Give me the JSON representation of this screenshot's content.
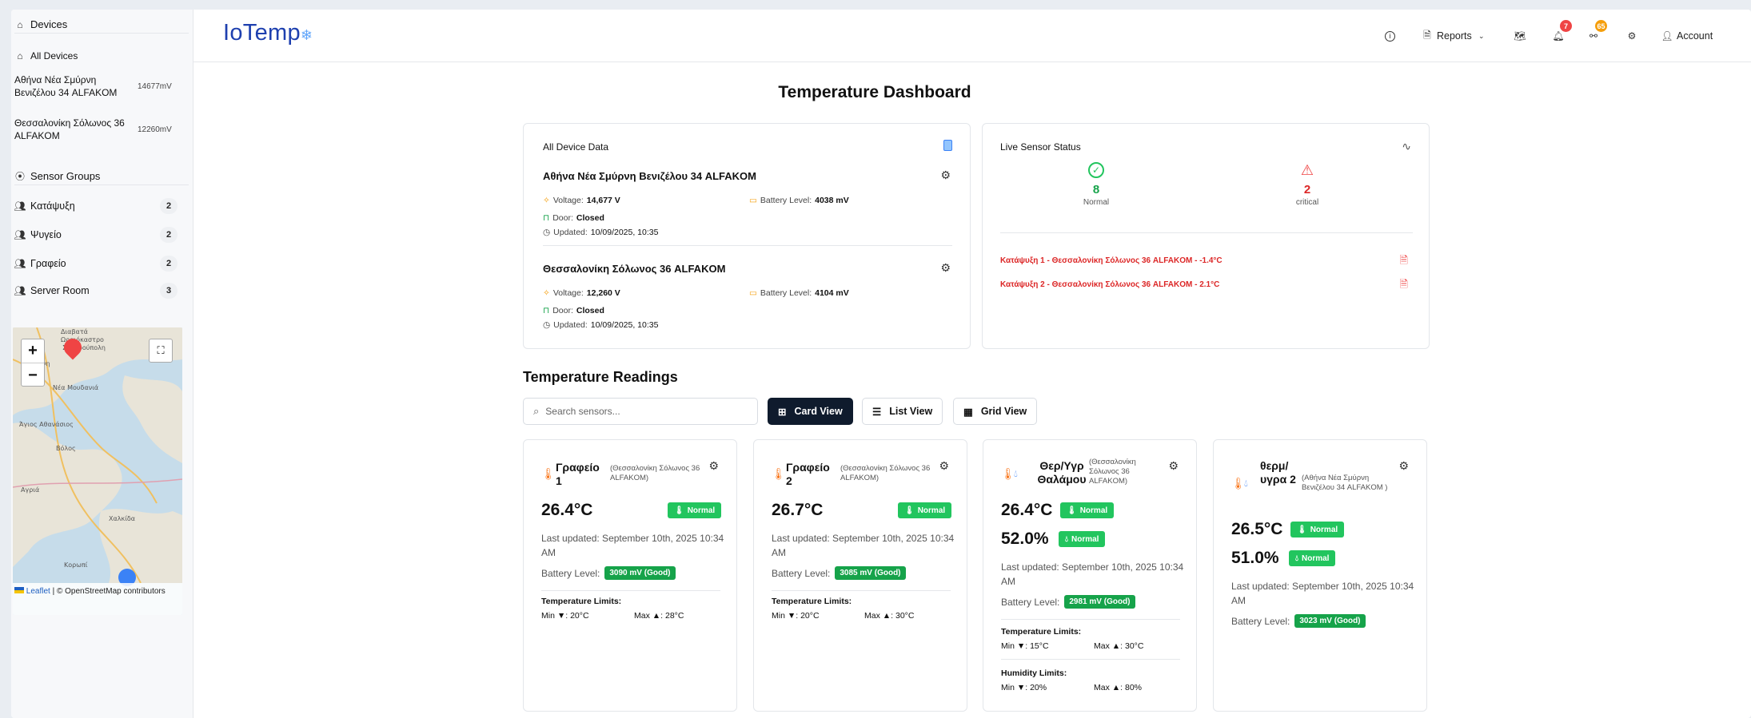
{
  "sidebar": {
    "devices_header": "Devices",
    "all_devices": "All Devices",
    "devices": [
      {
        "name": "Αθήνα Νέα Σμύρνη Βενιζέλου 34 ALFAKOM",
        "mv": "14677mV"
      },
      {
        "name": "Θεσσαλονίκη Σόλωνος 36 ALFAKOM",
        "mv": "12260mV"
      }
    ],
    "groups_header": "Sensor Groups",
    "groups": [
      {
        "name": "Κατάψυξη",
        "count": "2"
      },
      {
        "name": "Ψυγείο",
        "count": "2"
      },
      {
        "name": "Γραφείο",
        "count": "2"
      },
      {
        "name": "Server Room",
        "count": "3"
      }
    ],
    "map": {
      "zoom_in": "+",
      "zoom_out": "−",
      "attribution_leaflet": "Leaflet",
      "attribution_rest": "| © OpenStreetMap contributors",
      "places": [
        "Διαβατά",
        "Ωραιόκαστρο",
        "Σταυρούπολη",
        "Πολίχνη",
        "Νέα Μουδανιά",
        "Άγιος Αθανάσιος",
        "Βόλος",
        "Αγριά",
        "Χαλκίδα",
        "Κορωπί"
      ]
    }
  },
  "topbar": {
    "brand": "IoTemp",
    "brand_mark": "❄",
    "reports": "Reports",
    "notif_count": "7",
    "alert_count": "65",
    "account": "Account",
    "colors": {
      "notif": "#ef4444",
      "alert": "#f59e0b",
      "brand": "#1e40af"
    }
  },
  "dashboard": {
    "title": "Temperature Dashboard",
    "all_device_data": {
      "title": "All Device Data",
      "devices": [
        {
          "name": "Αθήνα Νέα Σμύρνη Βενιζέλου 34 ALFAKOM",
          "voltage_label": "Voltage:",
          "voltage": "14,677 V",
          "battery_label": "Battery Level:",
          "battery": "4038 mV",
          "door_label": "Door:",
          "door": "Closed",
          "updated_label": "Updated:",
          "updated": "10/09/2025, 10:35"
        },
        {
          "name": "Θεσσαλονίκη Σόλωνος 36 ALFAKOM",
          "voltage_label": "Voltage:",
          "voltage": "12,260 V",
          "battery_label": "Battery Level:",
          "battery": "4104 mV",
          "door_label": "Door:",
          "door": "Closed",
          "updated_label": "Updated:",
          "updated": "10/09/2025, 10:35"
        }
      ]
    },
    "live_status": {
      "title": "Live Sensor Status",
      "normal_count": "8",
      "normal_label": "Normal",
      "critical_count": "2",
      "critical_label": "critical",
      "alerts": [
        "Κατάψυξη 1 - Θεσσαλονίκη Σόλωνος 36 ALFAKOM - -1.4°C",
        "Κατάψυξη 2 - Θεσσαλονίκη Σόλωνος 36 ALFAKOM - 2.1°C"
      ]
    },
    "readings_title": "Temperature Readings",
    "search_placeholder": "Search sensors...",
    "views": {
      "card": "Card View",
      "list": "List View",
      "grid": "Grid View"
    },
    "cards": [
      {
        "name": "Γραφείο",
        "num": "1",
        "location": "(Θεσσαλονίκη Σόλωνος 36 ALFAKOM)",
        "temp": "26.4°C",
        "temp_status": "Normal",
        "updated": "Last updated: September 10th, 2025 10:34 AM",
        "battery_label": "Battery Level:",
        "battery": "3090 mV (Good)",
        "limits_title": "Temperature Limits:",
        "min": "Min ▼: 20°C",
        "max": "Max ▲: 28°C"
      },
      {
        "name": "Γραφείο",
        "num": "2",
        "location": "(Θεσσαλονίκη Σόλωνος 36 ALFAKOM)",
        "temp": "26.7°C",
        "temp_status": "Normal",
        "updated": "Last updated: September 10th, 2025 10:34 AM",
        "battery_label": "Battery Level:",
        "battery": "3085 mV (Good)",
        "limits_title": "Temperature Limits:",
        "min": "Min ▼: 20°C",
        "max": "Max ▲: 30°C"
      },
      {
        "name": "Θερ/Υγρ Θαλάμου",
        "location": "(Θεσσαλονίκη Σόλωνος 36 ALFAKOM)",
        "temp": "26.4°C",
        "temp_status": "Normal",
        "humidity": "52.0%",
        "hum_status": "Normal",
        "updated": "Last updated: September 10th, 2025 10:34 AM",
        "battery_label": "Battery Level:",
        "battery": "2981 mV (Good)",
        "limits_title": "Temperature Limits:",
        "min": "Min ▼: 15°C",
        "max": "Max ▲: 30°C",
        "hum_limits_title": "Humidity Limits:",
        "hum_min": "Min ▼: 20%",
        "hum_max": "Max ▲: 80%"
      },
      {
        "name": "θερμ/ υγρα 2",
        "location": "(Αθήνα Νέα Σμύρνη Βενιζέλου 34 ALFAKOM )",
        "temp": "26.5°C",
        "temp_status": "Normal",
        "humidity": "51.0%",
        "hum_status": "Normal",
        "updated": "Last updated: September 10th, 2025 10:34 AM",
        "battery_label": "Battery Level:",
        "battery": "3023 mV (Good)"
      }
    ]
  }
}
